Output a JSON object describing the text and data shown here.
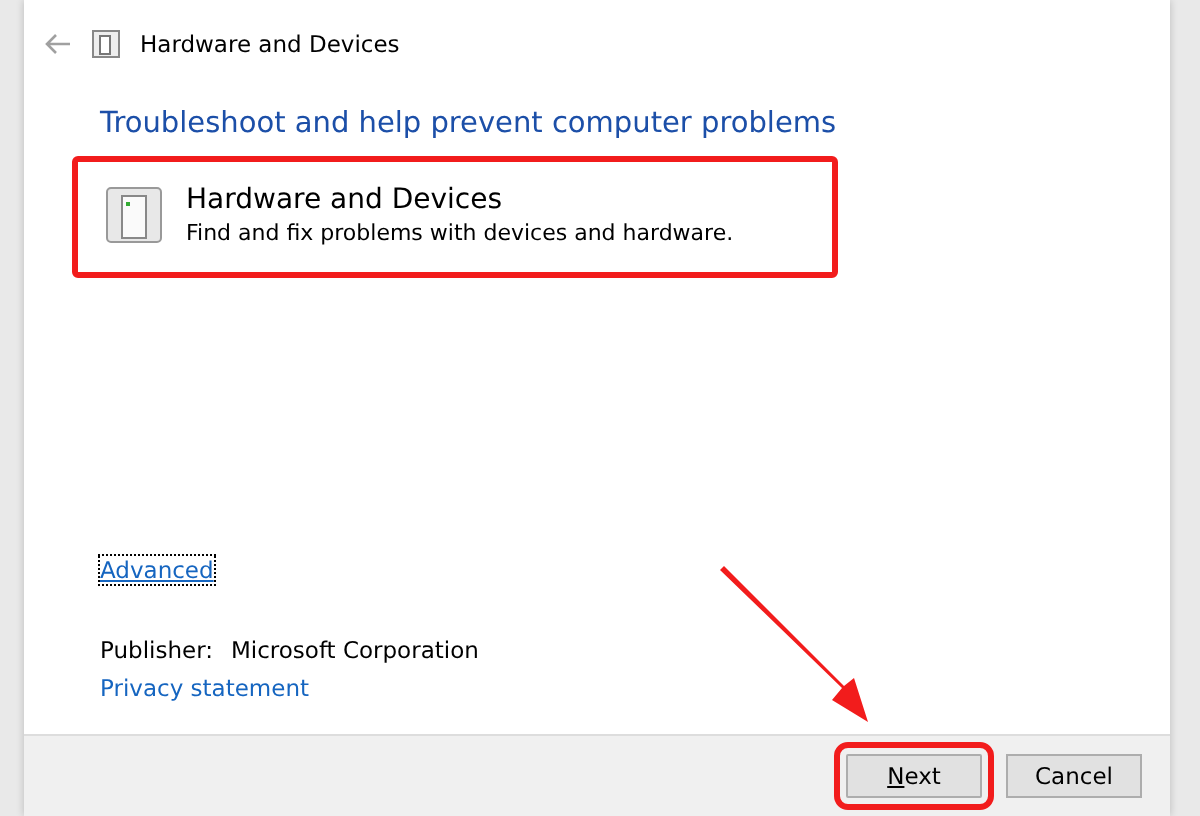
{
  "window": {
    "title": "Hardware and Devices"
  },
  "heading": "Troubleshoot and help prevent computer problems",
  "troubleshooter": {
    "title": "Hardware and Devices",
    "description": "Find and fix problems with devices and hardware."
  },
  "advanced_link": "Advanced",
  "publisher": {
    "label": "Publisher:",
    "value": "Microsoft Corporation"
  },
  "privacy_link": "Privacy statement",
  "buttons": [
    {
      "label": "Next",
      "kind": "default"
    },
    {
      "label": "Cancel",
      "kind": "normal"
    }
  ]
}
